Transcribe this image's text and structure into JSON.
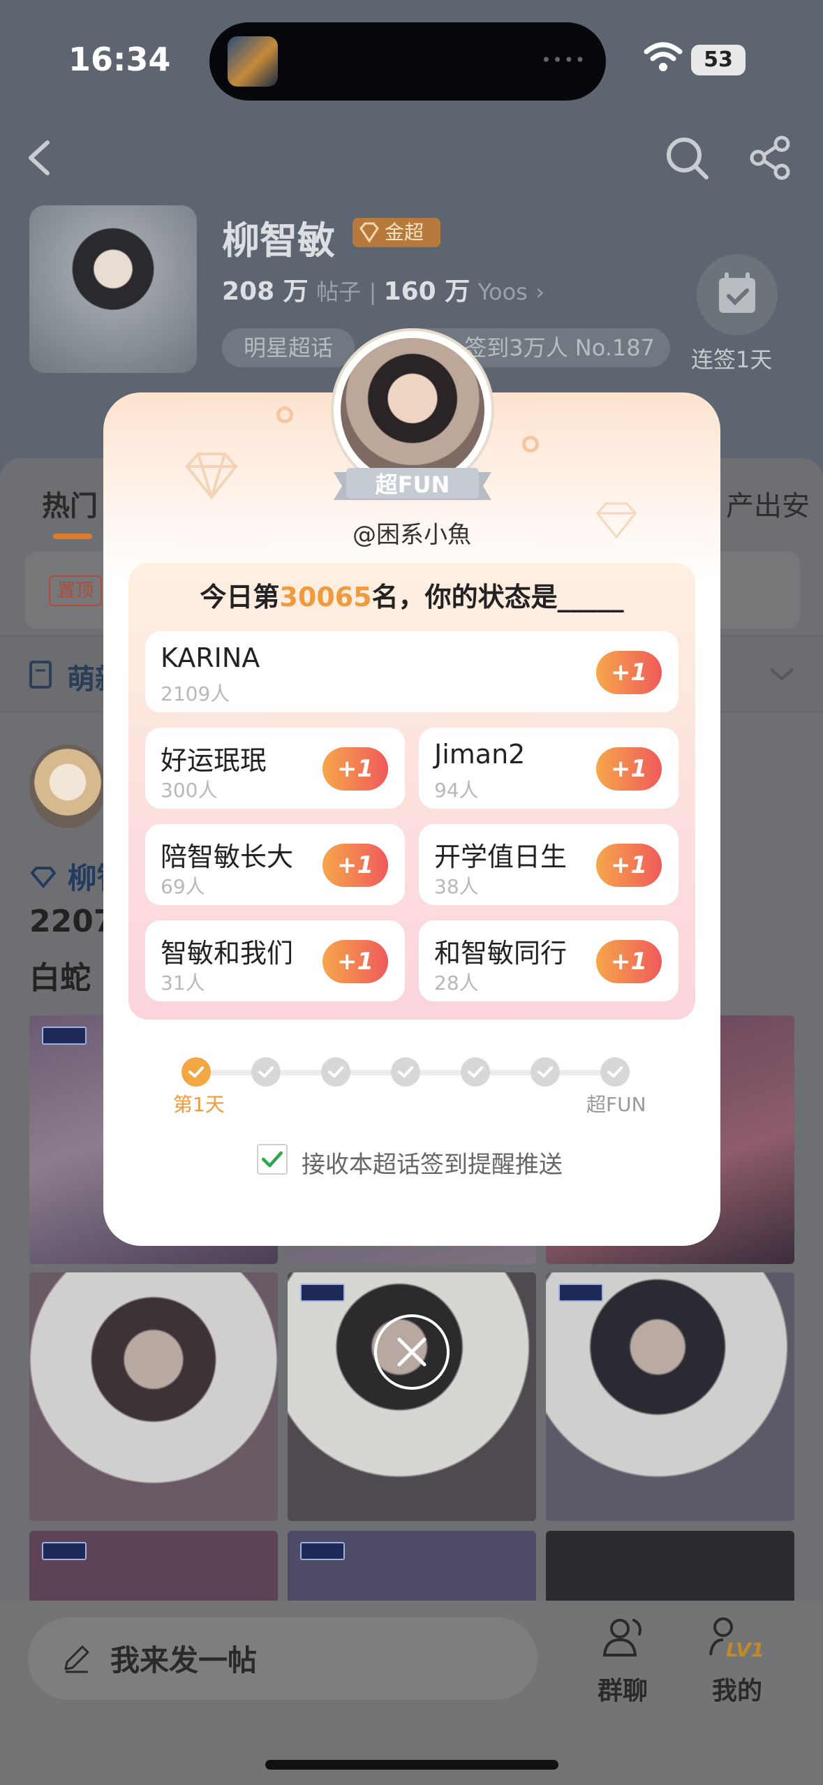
{
  "status_bar": {
    "time": "16:34",
    "battery": "53"
  },
  "header": {
    "title": "柳智敏",
    "badge": "金超",
    "posts_num": "208 万",
    "posts_label": "帖子",
    "yoos_num": "160 万",
    "yoos_label": "Yoos",
    "tag": "明星超话",
    "rank_text": "签到3万人 No.187",
    "checkin_label": "连签1天"
  },
  "background": {
    "tab_hot": "热门",
    "tab_right": "产出安",
    "pin_label": "置顶",
    "section_label": "萌新",
    "post_name": "柳智",
    "post_line1": "2207",
    "post_line2": "白蛇"
  },
  "modal": {
    "fun_label": "超FUN",
    "handle": "@困系小魚",
    "question_prefix": "今日第",
    "rank": "30065",
    "question_suffix": "名，你的状态是_____",
    "options": [
      {
        "name": "KARINA",
        "count": "2109人",
        "plus": "+1"
      },
      {
        "name": "好运珉珉",
        "count": "300人",
        "plus": "+1"
      },
      {
        "name": "Jiman2",
        "count": "94人",
        "plus": "+1"
      },
      {
        "name": "陪智敏长大",
        "count": "69人",
        "plus": "+1"
      },
      {
        "name": "开学值日生",
        "count": "38人",
        "plus": "+1"
      },
      {
        "name": "智敏和我们",
        "count": "31人",
        "plus": "+1"
      },
      {
        "name": "和智敏同行",
        "count": "28人",
        "plus": "+1"
      }
    ],
    "progress_start": "第1天",
    "progress_end": "超FUN",
    "progress_done": 1,
    "progress_total": 7,
    "reminder_label": "接收本超话签到提醒推送",
    "reminder_checked": true
  },
  "bottom_bar": {
    "post_placeholder": "我来发一帖",
    "group_label": "群聊",
    "me_label": "我的",
    "me_level": "LV1"
  },
  "colors": {
    "accent": "#f09a3e",
    "plus_start": "#f6a74c",
    "plus_end": "#ef5a5a",
    "check_green": "#2aa84a"
  }
}
